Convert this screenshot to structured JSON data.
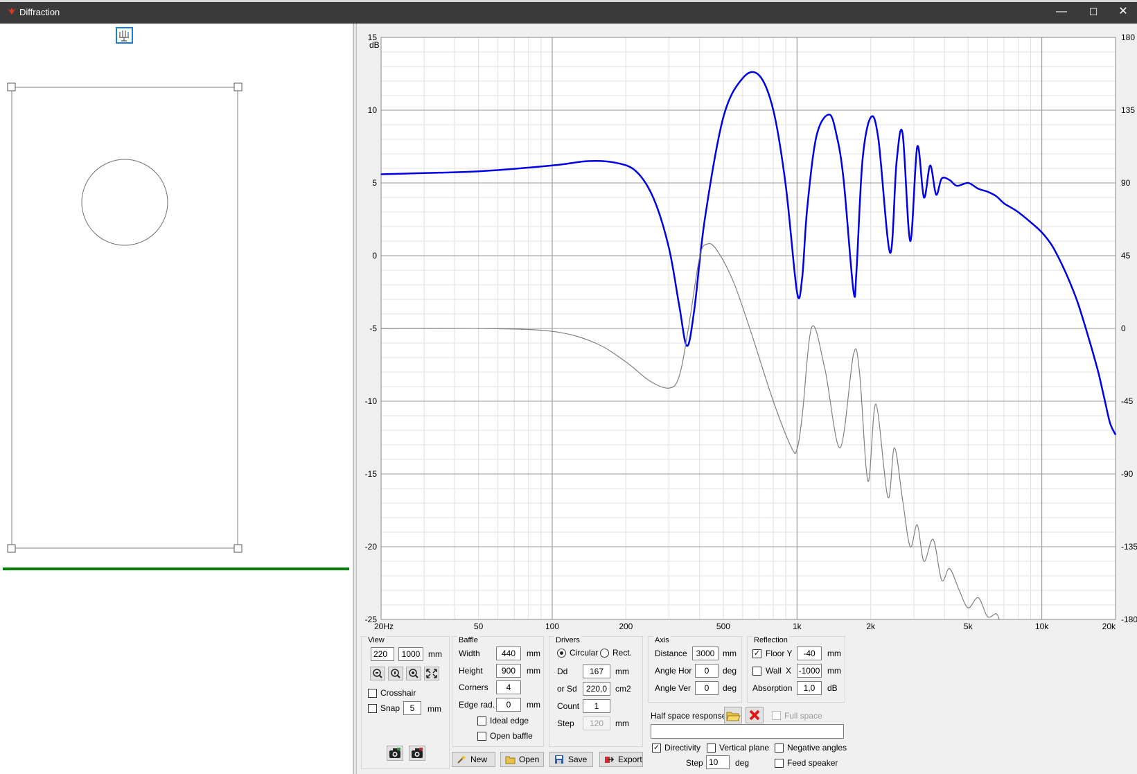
{
  "window": {
    "title": "Diffraction",
    "minimize": "—",
    "maximize": "☐",
    "close": "✕"
  },
  "colors": {
    "titlebar": "#3a3a3a",
    "response_curve": "#0000e6",
    "secondary_curve": "#808080",
    "green_bar": "#008000"
  },
  "chart_data": {
    "type": "line",
    "x_scale": "log",
    "xlim": [
      20,
      20000
    ],
    "ylim": [
      -25,
      15
    ],
    "ylabel": "dB",
    "y_ticks": [
      "15",
      "10",
      "5",
      "0",
      "-5",
      "-10",
      "-15",
      "-20",
      "-25"
    ],
    "y2_ticks": [
      "180",
      "135",
      "90",
      "45",
      "0",
      "-45",
      "-90",
      "-135",
      "-180"
    ],
    "x_ticks": [
      {
        "v": 20,
        "label": "20Hz"
      },
      {
        "v": 50,
        "label": "50"
      },
      {
        "v": 100,
        "label": "100"
      },
      {
        "v": 200,
        "label": "200"
      },
      {
        "v": 500,
        "label": "500"
      },
      {
        "v": 1000,
        "label": "1k"
      },
      {
        "v": 2000,
        "label": "2k"
      },
      {
        "v": 5000,
        "label": "5k"
      },
      {
        "v": 10000,
        "label": "10k"
      },
      {
        "v": 20000,
        "label": "20k"
      }
    ],
    "grid": true,
    "series": [
      {
        "color": "#0000e6",
        "x": [
          20,
          50,
          100,
          140,
          180,
          220,
          260,
          300,
          330,
          355,
          380,
          420,
          500,
          600,
          700,
          800,
          900,
          1000,
          1050,
          1100,
          1200,
          1350,
          1450,
          1550,
          1700,
          1750,
          1850,
          2000,
          2150,
          2400,
          2550,
          2700,
          2900,
          3100,
          3300,
          3500,
          3700,
          3900,
          4200,
          4500,
          5000,
          5500,
          6000,
          6500,
          7000,
          7500,
          8000,
          9000,
          10000,
          11000,
          12000,
          13000,
          14000,
          15000,
          16000,
          17000,
          18000,
          19000,
          20000
        ],
        "y": [
          5.6,
          5.8,
          6.2,
          6.5,
          6.4,
          5.8,
          3.9,
          0.5,
          -3.4,
          -6.2,
          -3.8,
          2.5,
          9.5,
          12.2,
          12.4,
          10.0,
          4.8,
          -2.5,
          -1.5,
          3.2,
          8.2,
          9.7,
          8.3,
          5.2,
          -2.4,
          -1.0,
          6.5,
          9.5,
          8.0,
          0.2,
          6.4,
          8.4,
          1.0,
          7.5,
          4.0,
          6.2,
          4.2,
          5.3,
          5.2,
          4.8,
          5.0,
          4.6,
          4.4,
          4.1,
          3.6,
          3.3,
          3.0,
          2.3,
          1.6,
          0.7,
          -0.5,
          -1.8,
          -3.2,
          -4.8,
          -6.4,
          -8.0,
          -9.8,
          -11.5,
          -12.3
        ]
      },
      {
        "color": "#808080",
        "x": [
          20,
          50,
          100,
          150,
          200,
          250,
          300,
          330,
          360,
          400,
          430,
          470,
          550,
          650,
          800,
          950,
          1000,
          1050,
          1150,
          1300,
          1500,
          1700,
          1800,
          1950,
          2100,
          2350,
          2500,
          2700,
          2900,
          3100,
          3300,
          3600,
          3900,
          4200,
          4600,
          5000,
          5500,
          6000,
          6500,
          6700
        ],
        "y": [
          -5.0,
          -5.0,
          -5.2,
          -6.0,
          -7.3,
          -8.6,
          -9.1,
          -8.3,
          -5.0,
          -0.1,
          0.8,
          0.4,
          -1.8,
          -5.3,
          -10.0,
          -13.2,
          -13.3,
          -11.0,
          -4.9,
          -7.8,
          -13.2,
          -6.8,
          -8.0,
          -15.5,
          -10.2,
          -16.6,
          -13.2,
          -16.8,
          -20.0,
          -18.5,
          -21.0,
          -19.5,
          -22.3,
          -21.5,
          -23.0,
          -24.2,
          -23.5,
          -24.8,
          -24.6,
          -25.0
        ]
      }
    ]
  },
  "view": {
    "label": "View",
    "x_value": "220",
    "y_value": "1000",
    "unit": "mm",
    "crosshair_label": "Crosshair",
    "snap_label": "Snap",
    "snap_value": "5",
    "snap_unit": "mm"
  },
  "baffle": {
    "label": "Baffle",
    "width_label": "Width",
    "width_value": "440",
    "width_unit": "mm",
    "height_label": "Height",
    "height_value": "900",
    "height_unit": "mm",
    "corners_label": "Corners",
    "corners_value": "4",
    "edge_label": "Edge rad.",
    "edge_value": "0",
    "edge_unit": "mm",
    "ideal_edge_label": "Ideal edge",
    "open_baffle_label": "Open baffle"
  },
  "drivers": {
    "label": "Drivers",
    "circular_label": "Circular",
    "rect_label": "Rect.",
    "dd_label": "Dd",
    "dd_value": "167",
    "dd_unit": "mm",
    "sd_label": "or Sd",
    "sd_value": "220,0",
    "sd_unit": "cm2",
    "count_label": "Count",
    "count_value": "1",
    "step_label": "Step",
    "step_value": "120",
    "step_unit": "mm"
  },
  "axis": {
    "label": "Axis",
    "distance_label": "Distance",
    "distance_value": "3000",
    "distance_unit": "mm",
    "angle_hor_label": "Angle Hor",
    "angle_hor_value": "0",
    "angle_hor_unit": "deg",
    "angle_ver_label": "Angle Ver",
    "angle_ver_value": "0",
    "angle_ver_unit": "deg"
  },
  "reflection": {
    "label": "Reflection",
    "floor_label": "Floor Y",
    "floor_value": "-40",
    "floor_unit": "mm",
    "wall_label": "Wall",
    "wall_axis": "X",
    "wall_value": "-1000",
    "wall_unit": "mm",
    "absorption_label": "Absorption",
    "absorption_value": "1,0",
    "absorption_unit": "dB"
  },
  "half_space": {
    "label": "Half space response",
    "full_space_label": "Full space",
    "file_value": ""
  },
  "directivity": {
    "directivity_label": "Directivity",
    "vertical_plane_label": "Vertical plane",
    "negative_angles_label": "Negative angles",
    "step_label": "Step",
    "step_value": "10",
    "step_unit": "deg",
    "feed_speaker_label": "Feed speaker"
  },
  "buttons": {
    "new": "New",
    "open": "Open",
    "save": "Save",
    "export": "Export"
  }
}
